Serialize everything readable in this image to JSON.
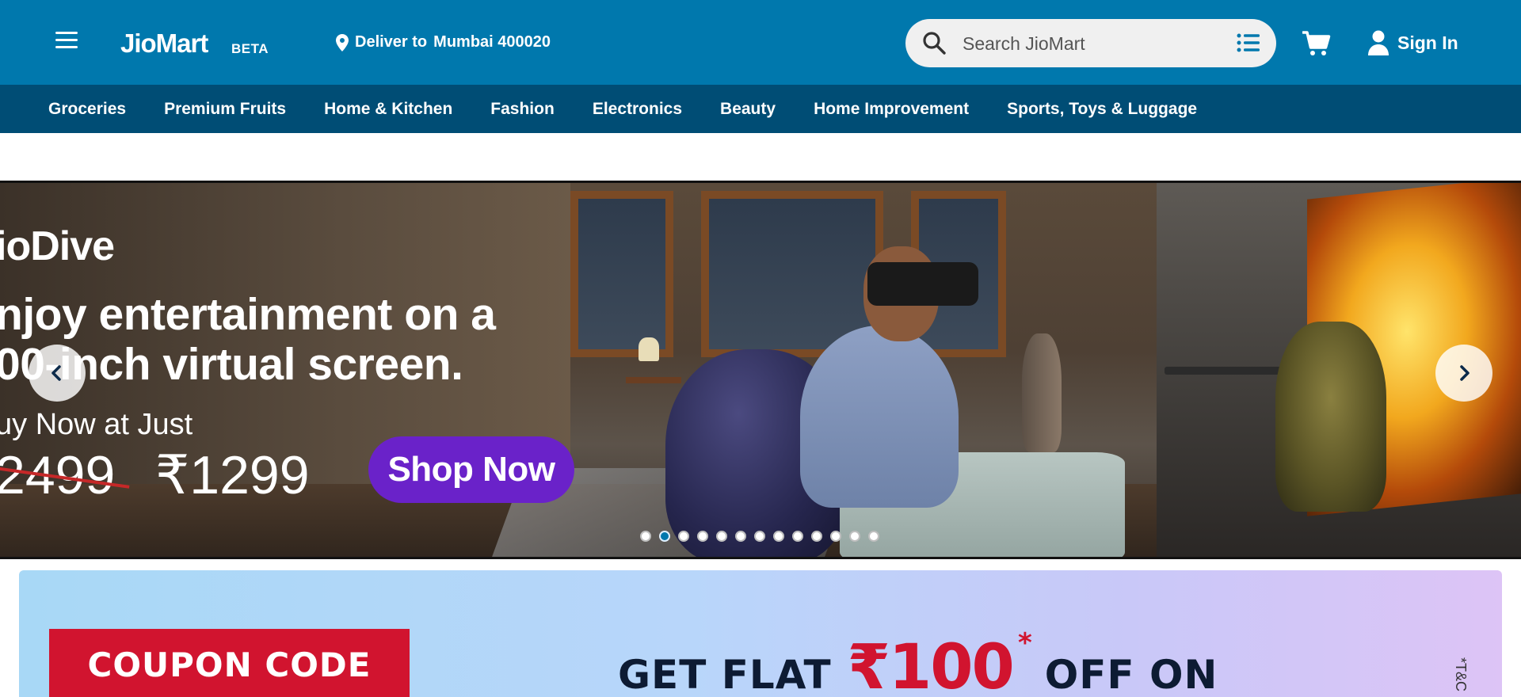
{
  "header": {
    "logo": "JioMart",
    "logo_badge": "BETA",
    "deliver_label": "Deliver to",
    "deliver_location": "Mumbai 400020",
    "search_placeholder": "Search JioMart",
    "signin_label": "Sign In"
  },
  "nav": {
    "items": [
      "Groceries",
      "Premium Fruits",
      "Home & Kitchen",
      "Fashion",
      "Electronics",
      "Beauty",
      "Home Improvement",
      "Sports, Toys & Luggage"
    ]
  },
  "carousel": {
    "brand": "ioDive",
    "headline_1": "njoy entertainment on a",
    "headline_2": "00-inch virtual screen.",
    "buy_line": "uy Now at Just",
    "price_old": "2499",
    "price_new": "₹1299",
    "cta": "Shop Now",
    "slide_count": 13,
    "active_slide_index": 1
  },
  "coupon_banner": {
    "coupon_label": "COUPON CODE",
    "offer_prefix": "GET FLAT",
    "offer_amount": "₹100",
    "offer_mark": "*",
    "offer_suffix": "OFF ON",
    "tnc": "*T&C"
  },
  "colors": {
    "header_bg": "#0078ad",
    "nav_bg": "#004d75",
    "cta_purple": "#6a22c9",
    "coupon_red": "#d1142f"
  }
}
